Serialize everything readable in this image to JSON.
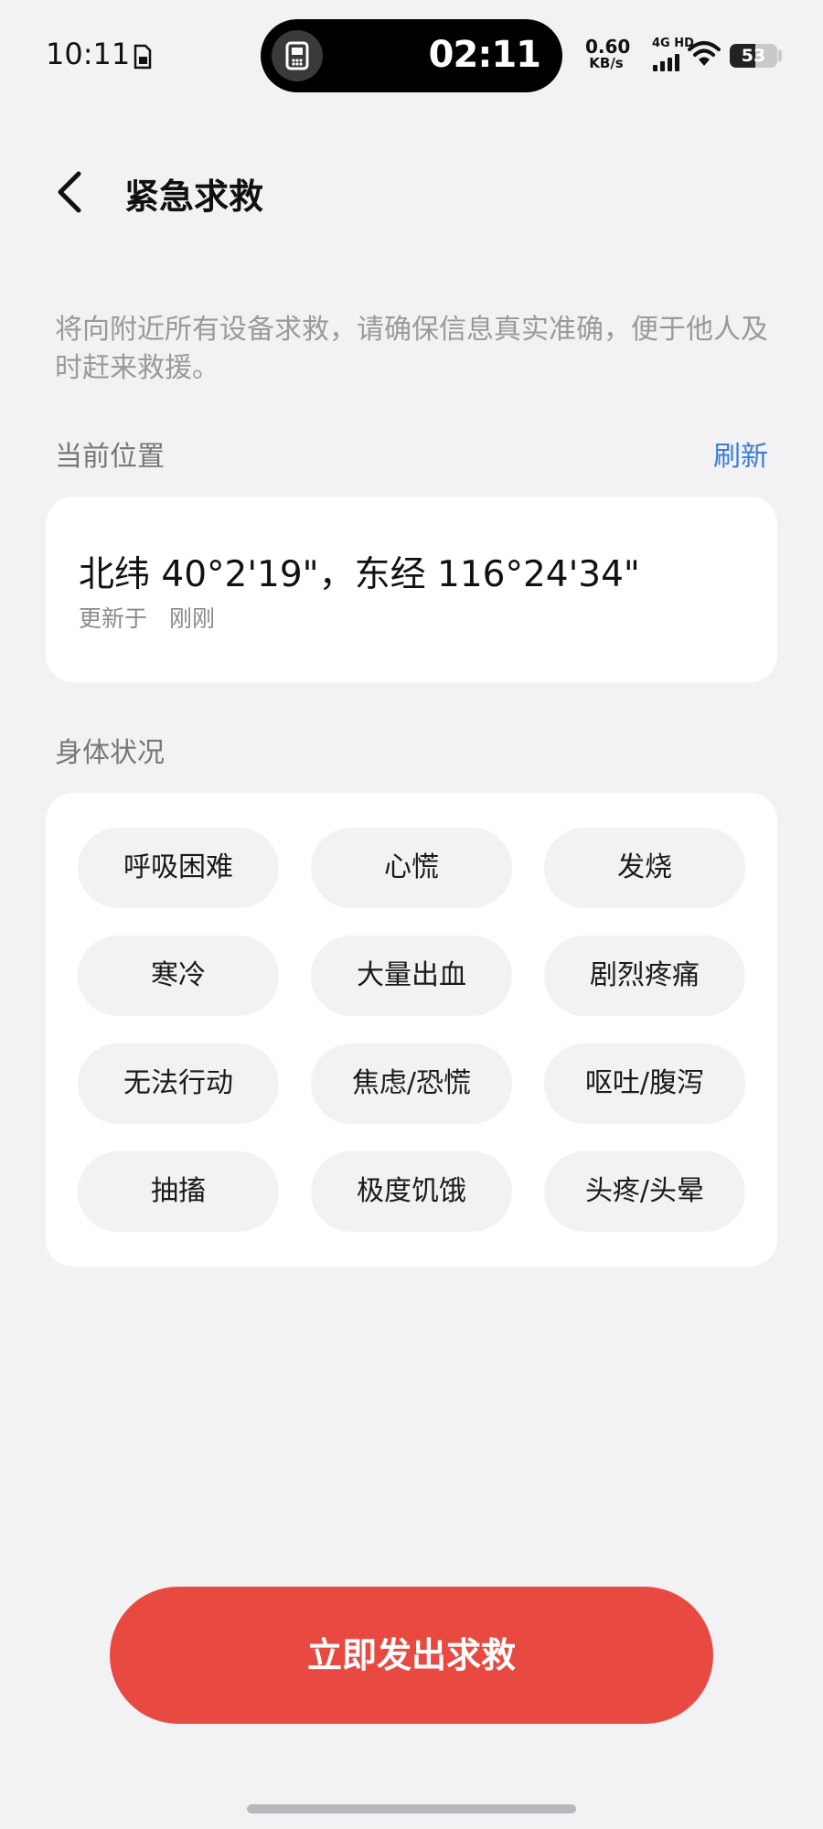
{
  "status_bar": {
    "time": "10:11",
    "timer": "02:11",
    "net_speed_value": "0.60",
    "net_speed_unit": "KB/s",
    "network_label": "4G HD",
    "battery_level": "53",
    "battery_fraction": 0.53,
    "icons": [
      "sim-card-icon",
      "call-active-icon",
      "signal-icon",
      "wifi-icon",
      "battery-icon"
    ]
  },
  "header": {
    "back_icon": "chevron-left-icon",
    "title": "紧急求救"
  },
  "notice": "将向附近所有设备求救，请确保信息真实准确，便于他人及时赶来救援。",
  "location": {
    "label": "当前位置",
    "refresh_label": "刷新",
    "coordinates": "北纬 40°2'19\"，东经 116°24'34\"",
    "updated_prefix": "更新于",
    "updated_value": "刚刚"
  },
  "condition": {
    "label": "身体状况",
    "options": [
      "呼吸困难",
      "心慌",
      "发烧",
      "寒冷",
      "大量出血",
      "剧烈疼痛",
      "无法行动",
      "焦虑/恐慌",
      "呕吐/腹泻",
      "抽搐",
      "极度饥饿",
      "头疼/头晕"
    ]
  },
  "sos_button": "立即发出求救",
  "colors": {
    "accent_link": "#3c7cd4",
    "sos_red": "#e84a42",
    "background": "#f2f2f4"
  }
}
